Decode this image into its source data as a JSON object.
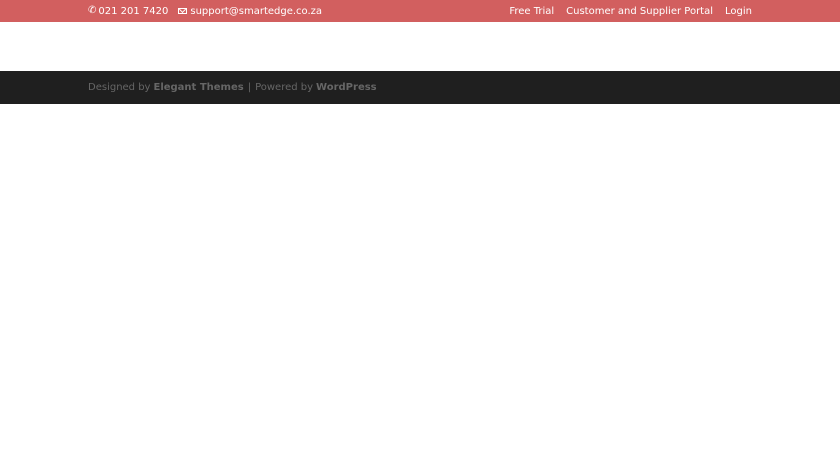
{
  "top_bar": {
    "phone": "021 201 7420",
    "email": "support@smartedge.co.za",
    "nav": {
      "free_trial": "Free Trial",
      "portal": "Customer and Supplier Portal",
      "login": "Login"
    }
  },
  "footer": {
    "designed_by": "Designed by",
    "elegant_themes": "Elegant Themes",
    "separator": "|",
    "powered_by": "Powered by",
    "wordpress": "WordPress"
  },
  "colors": {
    "top_bar_bg": "#d25f5f",
    "footer_bg": "#1f1f1f",
    "footer_text": "#666666"
  },
  "icons": {
    "phone": "phone-icon",
    "email": "envelope-icon"
  }
}
